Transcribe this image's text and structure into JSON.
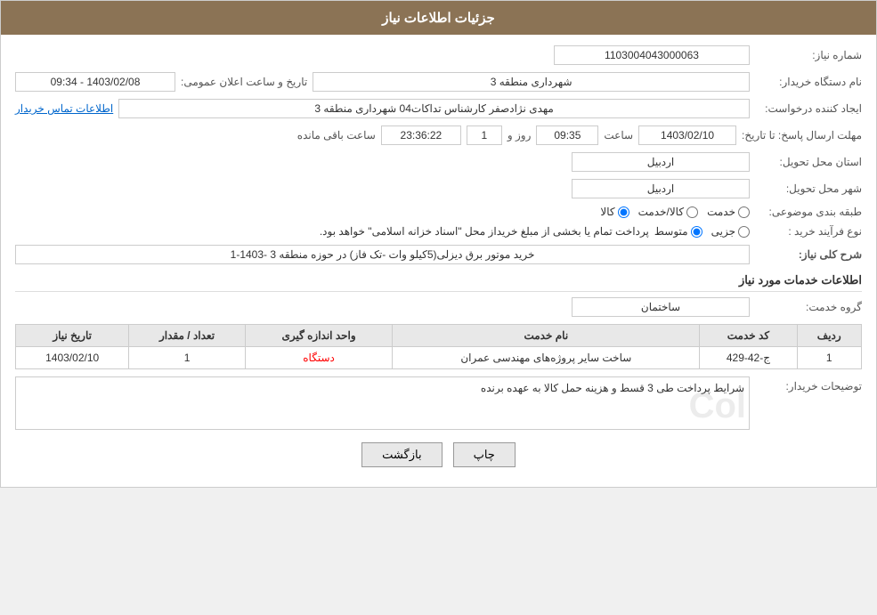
{
  "header": {
    "title": "جزئیات اطلاعات نیاز"
  },
  "fields": {
    "request_number_label": "شماره نیاز:",
    "request_number_value": "1103004043000063",
    "buyer_org_label": "نام دستگاه خریدار:",
    "buyer_org_value": "شهرداری منطقه 3",
    "creator_label": "ایجاد کننده درخواست:",
    "creator_value": "مهدی نژادصفر کارشناس تداکات04 شهرداری منطقه 3",
    "contact_link": "اطلاعات تماس خریدار",
    "send_deadline_label": "مهلت ارسال پاسخ: تا تاریخ:",
    "send_date": "1403/02/10",
    "send_time_label": "ساعت",
    "send_time": "09:35",
    "days_label": "روز و",
    "days_value": "1",
    "time_remaining": "23:36:22",
    "time_remaining_suffix": "ساعت باقی مانده",
    "province_label": "استان محل تحویل:",
    "province_value": "اردبیل",
    "city_label": "شهر محل تحویل:",
    "city_value": "اردبیل",
    "category_label": "طبقه بندی موضوعی:",
    "category_options": [
      "خدمت",
      "کالا/خدمت",
      "کالا"
    ],
    "category_selected": "کالا",
    "process_label": "نوع فرآیند خرید :",
    "process_options": [
      "جزیی",
      "متوسط"
    ],
    "process_note": "پرداخت تمام یا بخشی از مبلغ خریداز محل \"اسناد خزانه اسلامی\" خواهد بود.",
    "announcement_label": "تاریخ و ساعت اعلان عمومی:",
    "announcement_value": "1403/02/08 - 09:34"
  },
  "narration": {
    "section_title": "شرح کلی نیاز:",
    "value": "خرید موتور برق دیزلی(5کیلو وات -تک فاز) در حوزه منطقه 3 -1403-1"
  },
  "service_info": {
    "section_title": "اطلاعات خدمات مورد نیاز",
    "group_label": "گروه خدمت:",
    "group_value": "ساختمان",
    "table": {
      "headers": [
        "ردیف",
        "کد خدمت",
        "نام خدمت",
        "واحد اندازه گیری",
        "تعداد / مقدار",
        "تاریخ نیاز"
      ],
      "rows": [
        {
          "row_num": "1",
          "service_code": "ج-42-429",
          "service_name": "ساخت سایر پروژه‌های مهندسی عمران",
          "unit": "دستگاه",
          "quantity": "1",
          "date": "1403/02/10"
        }
      ],
      "unit_color": "red"
    }
  },
  "buyer_desc": {
    "label": "توضیحات خریدار:",
    "value": "شرایط پرداخت طی 3 قسط و هزینه حمل کالا به عهده برنده"
  },
  "buttons": {
    "print_label": "چاپ",
    "back_label": "بازگشت"
  }
}
